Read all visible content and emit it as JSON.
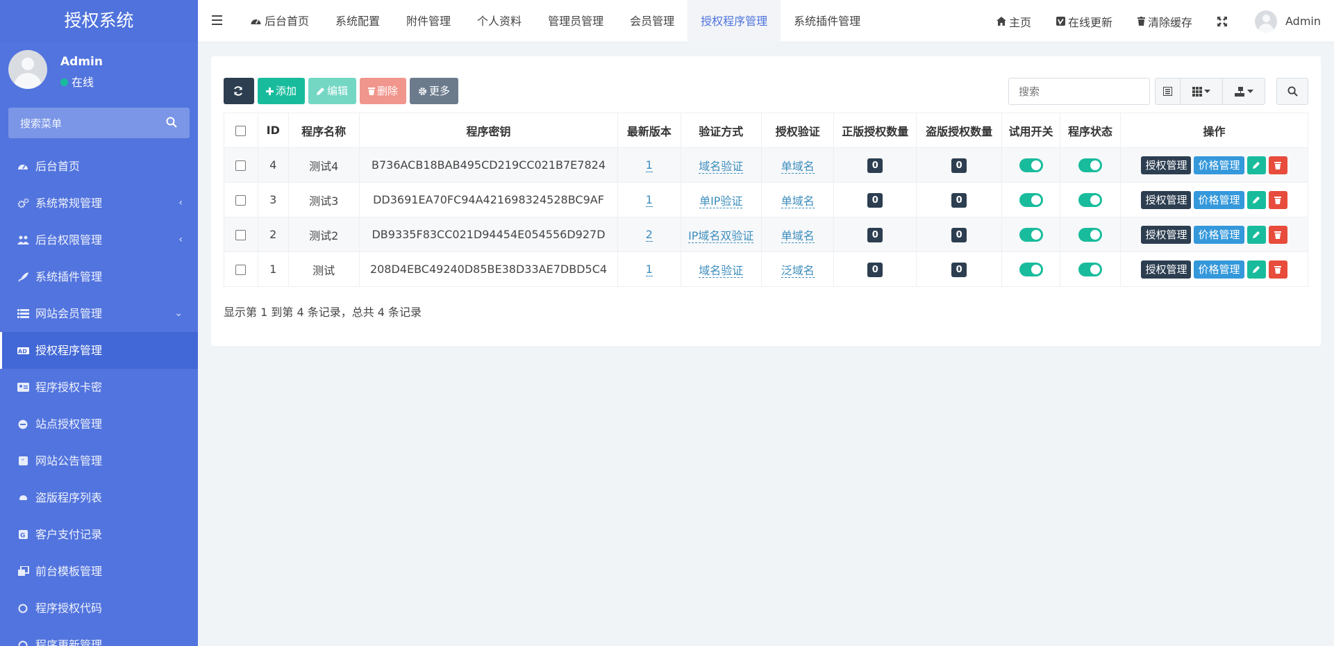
{
  "app": {
    "title": "授权系统"
  },
  "user": {
    "name": "Admin",
    "status": "在线"
  },
  "side_search": {
    "placeholder": "搜索菜单"
  },
  "sidebar": {
    "items": [
      {
        "label": "后台首页",
        "icon": "dashboard-icon"
      },
      {
        "label": "系统常规管理",
        "icon": "cogs-icon",
        "caret": "‹"
      },
      {
        "label": "后台权限管理",
        "icon": "users-icon",
        "caret": "‹"
      },
      {
        "label": "系统插件管理",
        "icon": "rocket-icon"
      },
      {
        "label": "网站会员管理",
        "icon": "list-icon",
        "caret": "⌄"
      },
      {
        "label": "授权程序管理",
        "icon": "ad-icon",
        "active": true
      },
      {
        "label": "程序授权卡密",
        "icon": "id-card-icon"
      },
      {
        "label": "站点授权管理",
        "icon": "ie-icon"
      },
      {
        "label": "网站公告管理",
        "icon": "quote-icon"
      },
      {
        "label": "盗版程序列表",
        "icon": "bug-icon"
      },
      {
        "label": "客户支付记录",
        "icon": "pay-icon"
      },
      {
        "label": "前台模板管理",
        "icon": "clone-icon"
      },
      {
        "label": "程序授权代码",
        "icon": "circle-icon"
      },
      {
        "label": "程序更新管理",
        "icon": "circle-icon"
      }
    ]
  },
  "topnav": {
    "tabs": [
      {
        "label": "后台首页"
      },
      {
        "label": "系统配置"
      },
      {
        "label": "附件管理"
      },
      {
        "label": "个人资料"
      },
      {
        "label": "管理员管理"
      },
      {
        "label": "会员管理"
      },
      {
        "label": "授权程序管理",
        "active": true
      },
      {
        "label": "系统插件管理"
      }
    ],
    "right": {
      "home": "主页",
      "update": "在线更新",
      "clear": "清除缓存",
      "user": "Admin"
    }
  },
  "toolbar": {
    "add": "添加",
    "edit": "编辑",
    "delete": "删除",
    "more": "更多"
  },
  "search": {
    "placeholder": "搜索"
  },
  "table": {
    "headers": [
      "ID",
      "程序名称",
      "程序密钥",
      "最新版本",
      "验证方式",
      "授权验证",
      "正版授权数量",
      "盗版授权数量",
      "试用开关",
      "程序状态",
      "操作"
    ],
    "rows": [
      {
        "id": "4",
        "name": "测试4",
        "key": "B736ACB18BAB495CD219CC021B7E7824",
        "version": "1",
        "verify": "域名验证",
        "auth": "单域名",
        "legit": "0",
        "pirate": "0"
      },
      {
        "id": "3",
        "name": "测试3",
        "key": "DD3691EA70FC94A421698324528BC9AF",
        "version": "1",
        "verify": "单IP验证",
        "auth": "单域名",
        "legit": "0",
        "pirate": "0"
      },
      {
        "id": "2",
        "name": "测试2",
        "key": "DB9335F83CC021D94454E054556D927D",
        "version": "2",
        "verify": "IP域名双验证",
        "auth": "单域名",
        "legit": "0",
        "pirate": "0"
      },
      {
        "id": "1",
        "name": "测试",
        "key": "208D4EBC49240D85BE38D33AE7DBD5C4",
        "version": "1",
        "verify": "域名验证",
        "auth": "泛域名",
        "legit": "0",
        "pirate": "0"
      }
    ],
    "op_auth": "授权管理",
    "op_price": "价格管理"
  },
  "pager": {
    "text": "显示第 1 到第 4 条记录，总共 4 条记录"
  },
  "colors": {
    "sidebar": "#5274de",
    "primary": "#4e73df",
    "success": "#18bc9c",
    "dark": "#2c3e50",
    "info": "#3498db",
    "danger": "#e74c3c"
  }
}
